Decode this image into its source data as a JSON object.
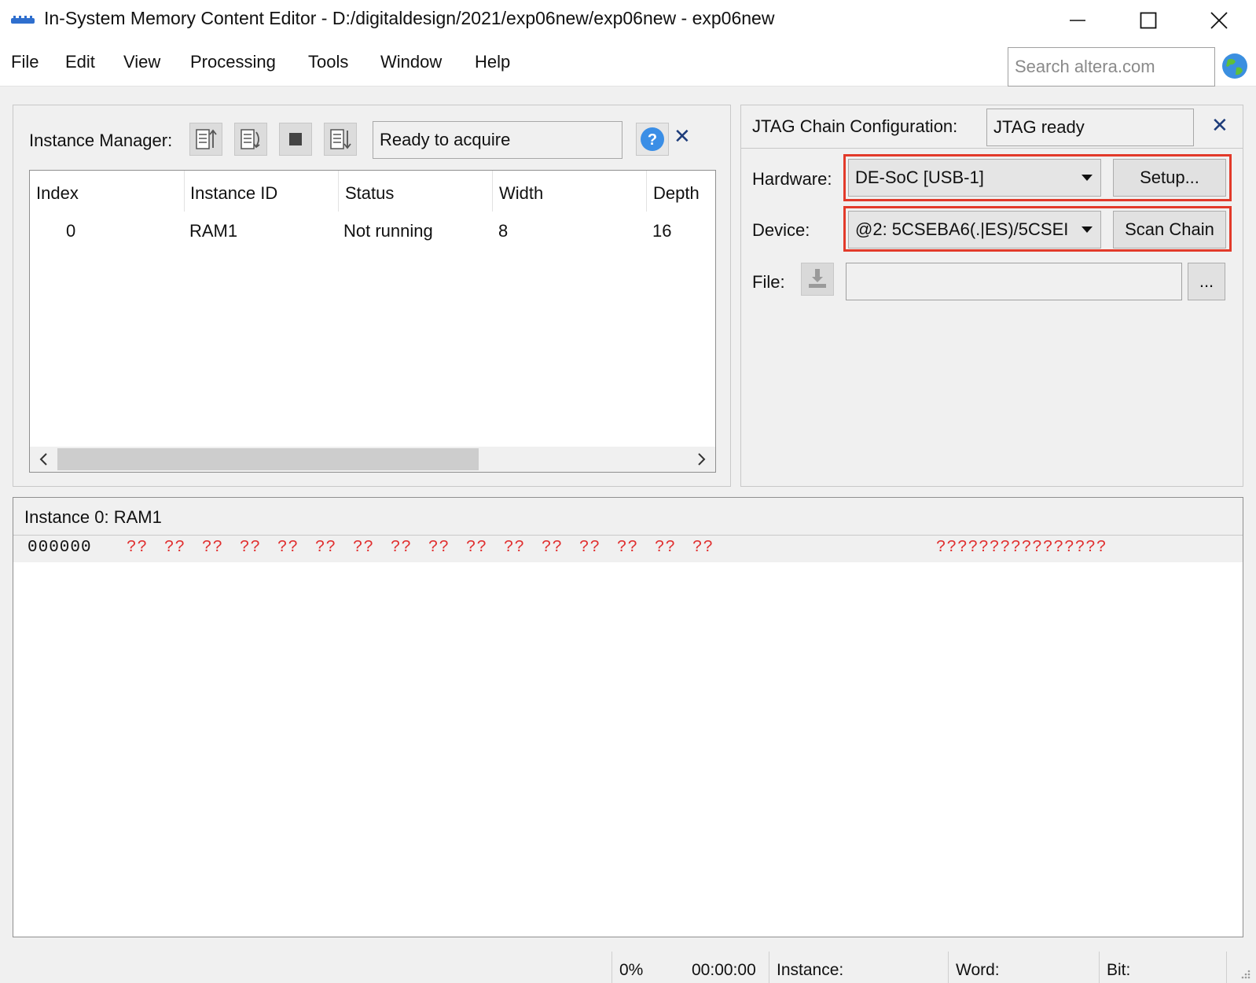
{
  "window": {
    "title": "In-System Memory Content Editor - D:/digitaldesign/2021/exp06new/exp06new - exp06new",
    "minimize": "minimize",
    "maximize": "maximize",
    "close": "close"
  },
  "menu": {
    "items": [
      "File",
      "Edit",
      "View",
      "Processing",
      "Tools",
      "Window",
      "Help"
    ],
    "search_placeholder": "Search altera.com"
  },
  "instance_manager": {
    "label": "Instance Manager:",
    "status": "Ready to acquire",
    "columns": [
      "Index",
      "Instance ID",
      "Status",
      "Width",
      "Depth"
    ],
    "rows": [
      {
        "index": "0",
        "instance_id": "RAM1",
        "status": "Not running",
        "width": "8",
        "depth": "16"
      }
    ],
    "scroll_position": 0
  },
  "jtag": {
    "label": "JTAG Chain Configuration:",
    "status": "JTAG ready",
    "hardware_label": "Hardware:",
    "hardware_value": "DE-SoC [USB-1]",
    "setup_button": "Setup...",
    "device_label": "Device:",
    "device_value": "@2: 5CSEBA6(.|ES)/5CSEI",
    "scan_button": "Scan Chain",
    "file_label": "File:",
    "file_value": "",
    "browse_button": "...",
    "highlight_color": "#e23a2a"
  },
  "memory": {
    "title": "Instance 0: RAM1",
    "rows": [
      {
        "address": "000000",
        "bytes": [
          "??",
          "??",
          "??",
          "??",
          "??",
          "??",
          "??",
          "??",
          "??",
          "??",
          "??",
          "??",
          "??",
          "??",
          "??",
          "??"
        ],
        "ascii": "????????????????"
      }
    ],
    "unknown_color": "#e03030"
  },
  "statusbar": {
    "progress": "0%",
    "time": "00:00:00",
    "instance_label": "Instance:",
    "word_label": "Word:",
    "bit_label": "Bit:"
  }
}
